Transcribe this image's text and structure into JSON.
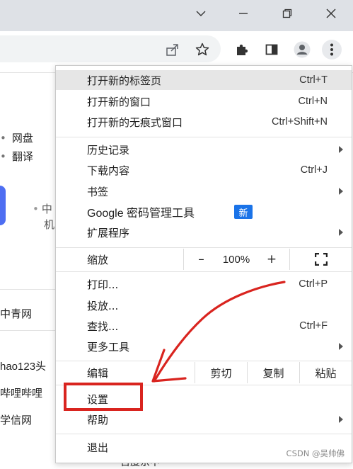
{
  "window": {
    "minimize_icon": "chevron-down-icon",
    "min_icon": "minimize-icon",
    "restore_icon": "restore-icon",
    "close_icon": "close-icon"
  },
  "toolbar": {
    "icons": [
      "share-icon",
      "star-icon",
      "extensions-icon",
      "sidepanel-icon",
      "profile-icon",
      "more-menu-icon"
    ]
  },
  "background_page": {
    "row1": "网盘",
    "row2": "翻译",
    "side_chars": [
      "中",
      "机"
    ],
    "link1": "中青网",
    "link2": "hao123头",
    "link3": "哔哩哔哩",
    "link4": "学信网",
    "bottom_text": "百度京中"
  },
  "menu": {
    "new_tab": "打开新的标签页",
    "new_tab_sc": "Ctrl+T",
    "new_window": "打开新的窗口",
    "new_window_sc": "Ctrl+N",
    "incognito": "打开新的无痕式窗口",
    "incognito_sc": "Ctrl+Shift+N",
    "history": "历史记录",
    "downloads": "下载内容",
    "downloads_sc": "Ctrl+J",
    "bookmarks": "书签",
    "password": "Google 密码管理工具",
    "password_badge": "新",
    "extensions": "扩展程序",
    "zoom": "缩放",
    "zoom_minus": "–",
    "zoom_value": "100%",
    "zoom_plus": "+",
    "print": "打印...",
    "print_sc": "Ctrl+P",
    "cast": "投放...",
    "find": "查找...",
    "find_sc": "Ctrl+F",
    "more_tools": "更多工具",
    "edit": "编辑",
    "cut": "剪切",
    "copy": "复制",
    "paste": "粘贴",
    "settings": "设置",
    "help": "帮助",
    "exit": "退出"
  },
  "annotation": {
    "color": "#d9241f"
  },
  "watermark": "CSDN @吴帅佛"
}
